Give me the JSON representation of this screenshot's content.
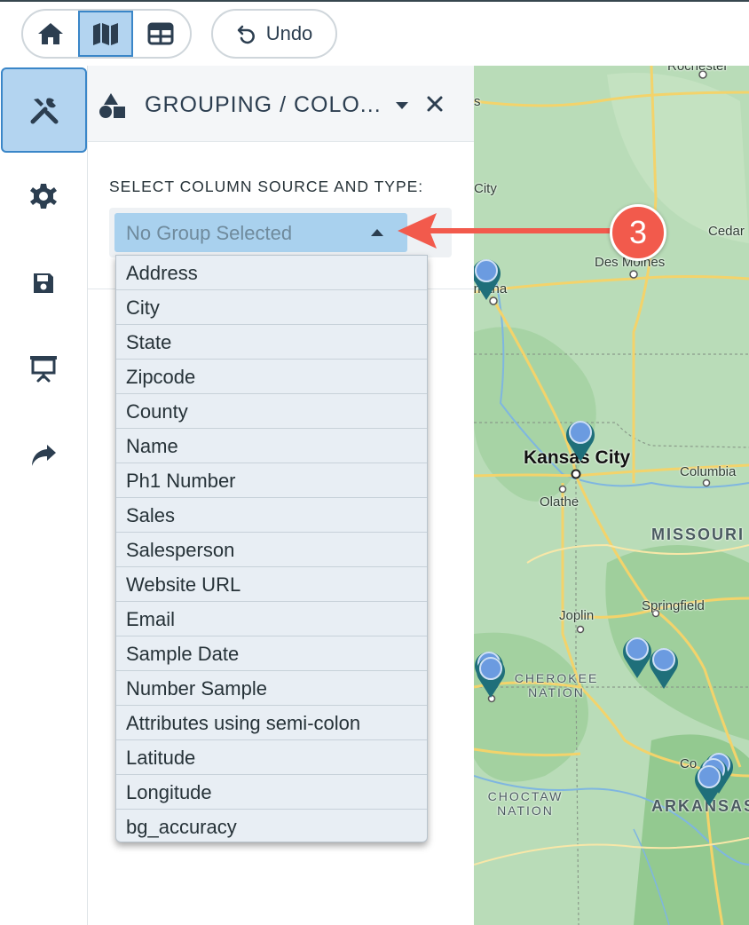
{
  "toolbar": {
    "view_buttons": [
      {
        "icon": "home-icon"
      },
      {
        "icon": "map-icon",
        "active": true
      },
      {
        "icon": "table-icon"
      }
    ],
    "undo_label": "Undo"
  },
  "rail": {
    "items": [
      {
        "icon": "tools-icon",
        "active": true
      },
      {
        "icon": "gear-icon"
      },
      {
        "icon": "save-icon"
      },
      {
        "icon": "presentation-icon"
      },
      {
        "icon": "share-icon"
      }
    ]
  },
  "panel": {
    "title": "GROUPING / COLO...",
    "section_label": "SELECT COLUMN SOURCE AND TYPE:",
    "select_value": "No Group Selected",
    "options": [
      "Address",
      "City",
      "State",
      "Zipcode",
      "County",
      "Name",
      "Ph1 Number",
      "Sales",
      "Salesperson",
      "Website URL",
      "Email",
      "Sample Date",
      "Number Sample",
      "Attributes using semi-colon",
      "Latitude",
      "Longitude",
      "bg_accuracy"
    ]
  },
  "map": {
    "labels": {
      "top_partial": "Rochester",
      "s": "s",
      "city": "City",
      "cedar": "Cedar",
      "des_moines": "Des Moines",
      "omaha": "Omaha",
      "kansas_city": "Kansas City",
      "columbia": "Columbia",
      "olathe": "Olathe",
      "missouri": "MISSOURI",
      "joplin": "Joplin",
      "springfield": "Springfield",
      "cherokee": "CHEROKEE NATION",
      "choctaw": "CHOCTAW NATION",
      "arkansas": "ARKANSAS",
      "co": "Co"
    }
  },
  "annotation": {
    "step": "3",
    "color": "#f25a4c"
  }
}
